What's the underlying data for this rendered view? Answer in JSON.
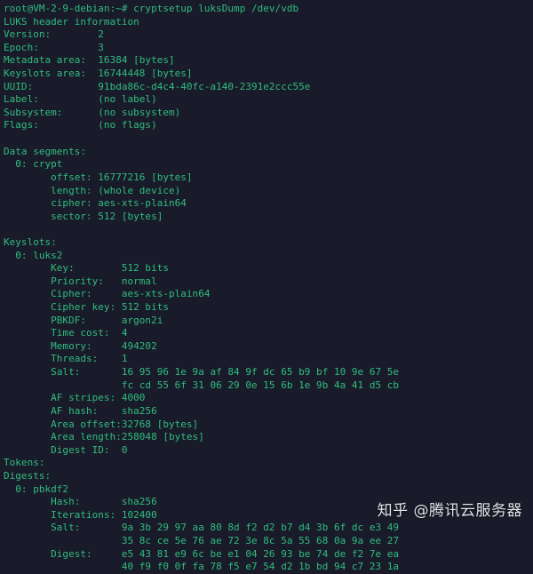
{
  "terminal": {
    "background_color": "#1a1b2a",
    "text_color": "#2ebd7e",
    "prompt": "root@VM-2-9-debian:~#",
    "command": "cryptsetup luksDump /dev/vdb",
    "lines": [
      "root@VM-2-9-debian:~# cryptsetup luksDump /dev/vdb",
      "LUKS header information",
      "Version:       \t2",
      "Epoch:         \t3",
      "Metadata area: \t16384 [bytes]",
      "Keyslots area: \t16744448 [bytes]",
      "UUID:          \t91bda86c-d4c4-40fc-a140-2391e2ccc55e",
      "Label:         \t(no label)",
      "Subsystem:     \t(no subsystem)",
      "Flags:         \t(no flags)",
      "",
      "Data segments:",
      "  0: crypt",
      "\toffset: 16777216 [bytes]",
      "\tlength: (whole device)",
      "\tcipher: aes-xts-plain64",
      "\tsector: 512 [bytes]",
      "",
      "Keyslots:",
      "  0: luks2",
      "\tKey:        512 bits",
      "\tPriority:   normal",
      "\tCipher:     aes-xts-plain64",
      "\tCipher key: 512 bits",
      "\tPBKDF:      argon2i",
      "\tTime cost:  4",
      "\tMemory:     494202",
      "\tThreads:    1",
      "\tSalt:       16 95 96 1e 9a af 84 9f dc 65 b9 bf 10 9e 67 5e",
      "\t            fc cd 55 6f 31 06 29 0e 15 6b 1e 9b 4a 41 d5 cb",
      "\tAF stripes: 4000",
      "\tAF hash:    sha256",
      "\tArea offset:32768 [bytes]",
      "\tArea length:258048 [bytes]",
      "\tDigest ID:  0",
      "Tokens:",
      "Digests:",
      "  0: pbkdf2",
      "\tHash:       sha256",
      "\tIterations: 102400",
      "\tSalt:       9a 3b 29 97 aa 80 8d f2 d2 b7 d4 3b 6f dc e3 49",
      "\t            35 8c ce 5e 76 ae 72 3e 8c 5a 55 68 0a 9a ee 27",
      "\tDigest:     e5 43 81 e9 6c be e1 04 26 93 be 74 de f2 7e ea",
      "\t            40 f9 f0 0f fa 78 f5 e7 54 d2 1b bd 94 c7 23 1a"
    ],
    "header_fields": {
      "title": "LUKS header information",
      "version": "2",
      "epoch": "3",
      "metadata_area": "16384 [bytes]",
      "keyslots_area": "16744448 [bytes]",
      "uuid": "91bda86c-d4c4-40fc-a140-2391e2ccc55e",
      "label": "(no label)",
      "subsystem": "(no subsystem)",
      "flags": "(no flags)"
    },
    "data_segments": {
      "title": "Data segments:",
      "index": "0: crypt",
      "offset": "16777216 [bytes]",
      "length": "(whole device)",
      "cipher": "aes-xts-plain64",
      "sector": "512 [bytes]"
    },
    "keyslots": {
      "title": "Keyslots:",
      "index": "0: luks2",
      "key": "512 bits",
      "priority": "normal",
      "cipher": "aes-xts-plain64",
      "cipher_key": "512 bits",
      "pbkdf": "argon2i",
      "time_cost": "4",
      "memory": "494202",
      "threads": "1",
      "salt_line1": "16 95 96 1e 9a af 84 9f dc 65 b9 bf 10 9e 67 5e",
      "salt_line2": "fc cd 55 6f 31 06 29 0e 15 6b 1e 9b 4a 41 d5 cb",
      "af_stripes": "4000",
      "af_hash": "sha256",
      "area_offset": "32768 [bytes]",
      "area_length": "258048 [bytes]",
      "digest_id": "0"
    },
    "tokens": {
      "title": "Tokens:"
    },
    "digests": {
      "title": "Digests:",
      "index": "0: pbkdf2",
      "hash": "sha256",
      "iterations": "102400",
      "salt_line1": "9a 3b 29 97 aa 80 8d f2 d2 b7 d4 3b 6f dc e3 49",
      "salt_line2": "35 8c ce 5e 76 ae 72 3e 8c 5a 55 68 0a 9a ee 27",
      "digest_line1": "e5 43 81 e9 6c be e1 04 26 93 be 74 de f2 7e ea",
      "digest_line2": "40 f9 f0 0f fa 78 f5 e7 54 d2 1b bd 94 c7 23 1a"
    }
  },
  "watermark": {
    "text": "知乎 @腾讯云服务器",
    "color": "#dfe2e8"
  }
}
